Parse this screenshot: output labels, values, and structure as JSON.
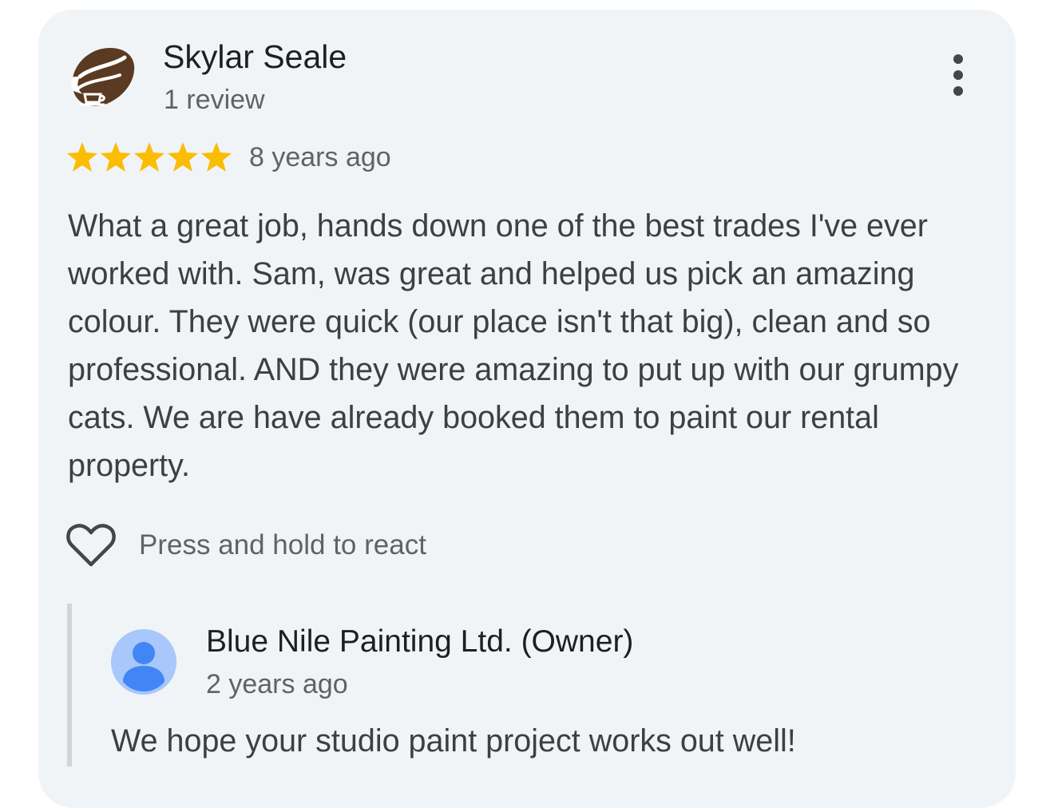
{
  "review": {
    "author": "Skylar Seale",
    "author_meta": "1 review",
    "avatar_icon": "coffee-bean-logo-icon",
    "rating": 5,
    "rating_max": 5,
    "star_color": "#fbbc04",
    "age": "8 years ago",
    "text": "What a great job, hands down one of the best trades I've ever worked with. Sam, was great and helped us pick an amazing colour. They were quick (our place isn't that big), clean and so professional. AND they were amazing to put up with our grumpy cats. We are have already booked them to paint our rental property.",
    "more_icon": "more-vert-icon",
    "react": {
      "icon": "heart-outline-icon",
      "label": "Press and hold to react"
    }
  },
  "owner_response": {
    "name": "Blue Nile Painting Ltd. (Owner)",
    "avatar_icon": "default-profile-icon",
    "age": "2 years ago",
    "text": "We hope your studio paint project works out well!"
  },
  "colors": {
    "card_background": "#f1f4f6",
    "avatar_brown": "#5a3a22",
    "owner_avatar_bg": "#a8c7fa",
    "owner_avatar_fg": "#4285f4"
  }
}
